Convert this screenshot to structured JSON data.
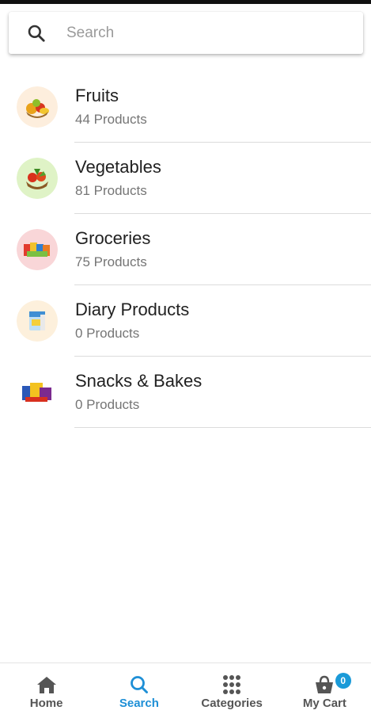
{
  "search": {
    "placeholder": "Search"
  },
  "categories": [
    {
      "name": "Fruits",
      "count": "44 Products",
      "image": "fruits-basket"
    },
    {
      "name": "Vegetables",
      "count": "81 Products",
      "image": "vegetables-basket"
    },
    {
      "name": "Groceries",
      "count": "75 Products",
      "image": "grocery-packs"
    },
    {
      "name": "Diary Products",
      "count": "0 Products",
      "image": "dairy-pack"
    },
    {
      "name": "Snacks & Bakes",
      "count": "0 Products",
      "image": "snack-packs"
    }
  ],
  "bottom_nav": {
    "items": [
      {
        "label": "Home",
        "icon": "home-icon"
      },
      {
        "label": "Search",
        "icon": "search-icon",
        "active": true
      },
      {
        "label": "Categories",
        "icon": "grid-icon"
      },
      {
        "label": "My Cart",
        "icon": "basket-icon"
      }
    ],
    "cart_count": "0"
  },
  "colors": {
    "accent": "#1e8fd6",
    "badge": "#1a9ad8",
    "text": "#212121",
    "subtext": "#757575"
  }
}
